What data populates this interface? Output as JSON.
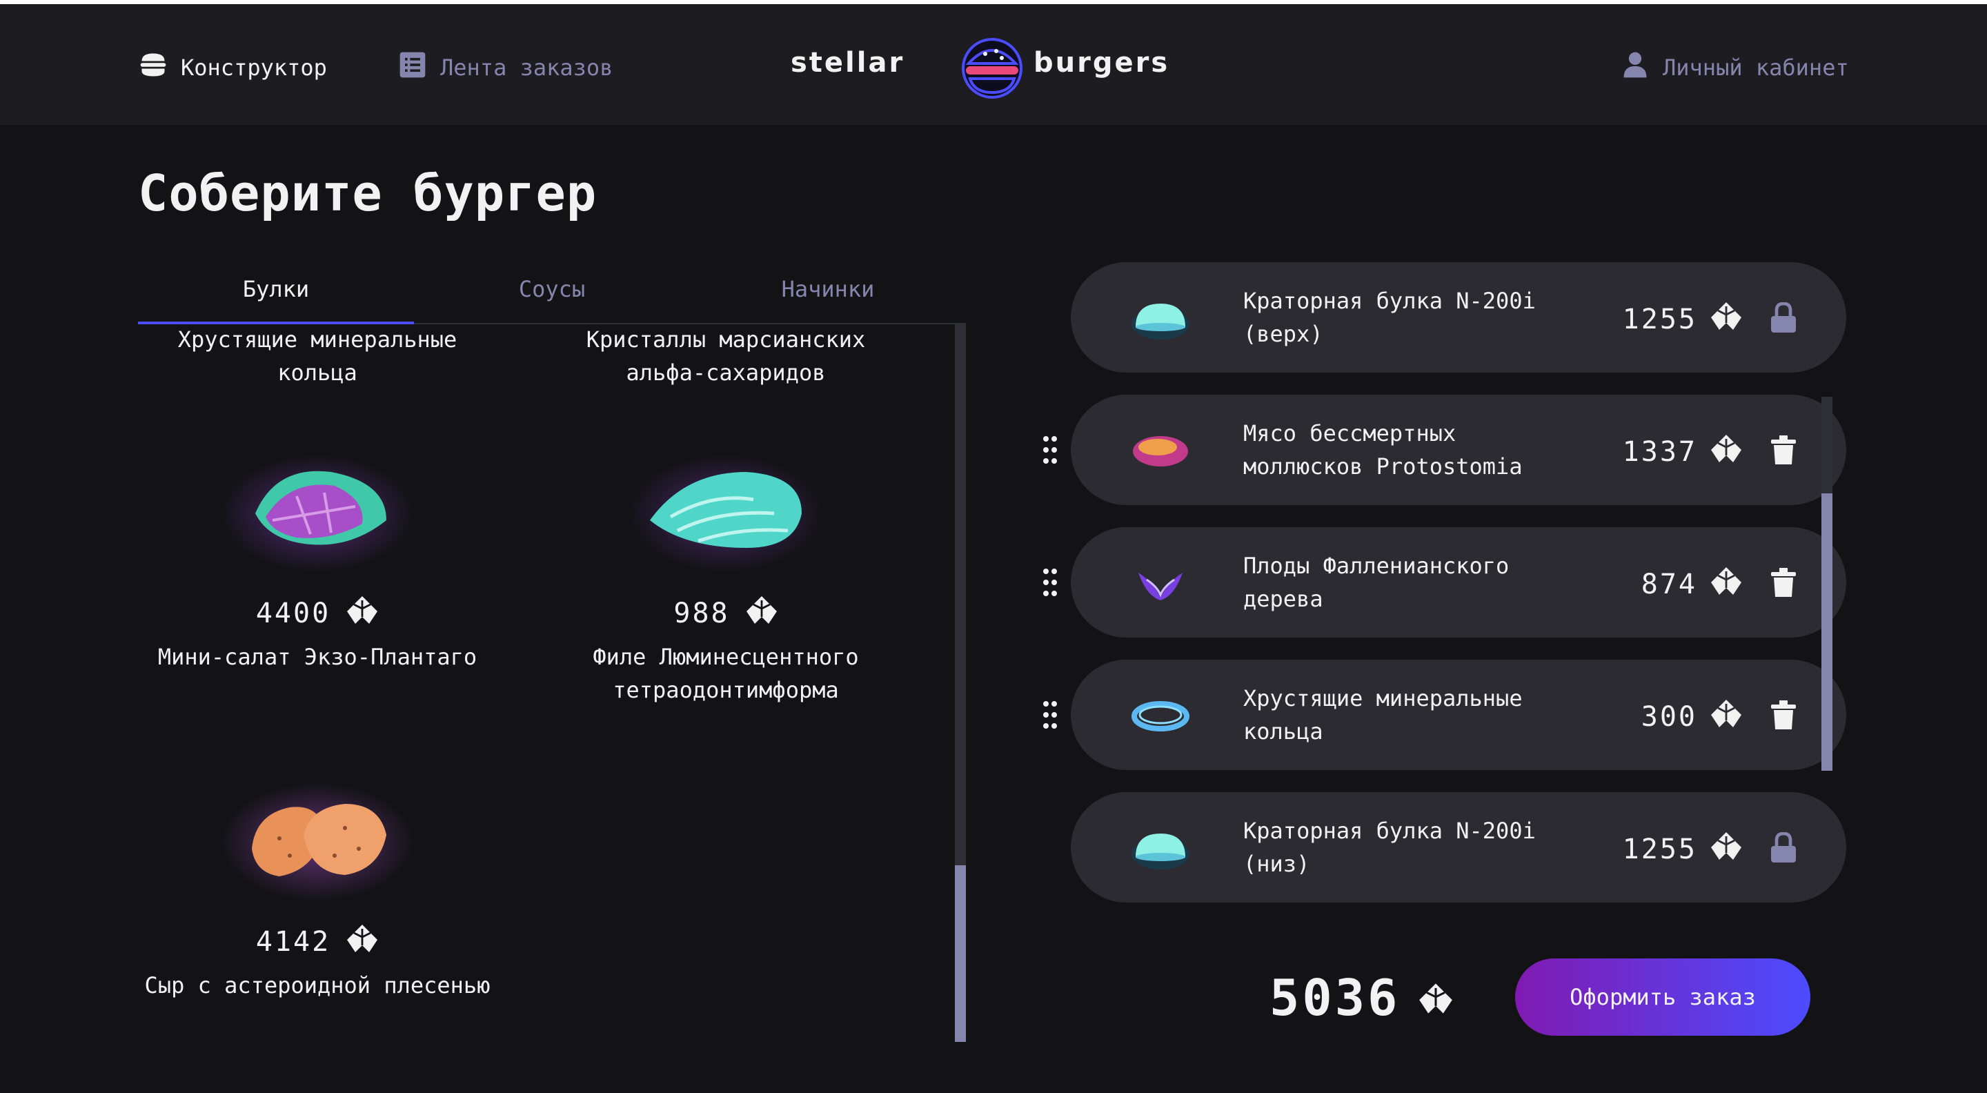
{
  "header": {
    "nav": {
      "constructor": "Конструктор",
      "feed": "Лента заказов",
      "profile": "Личный кабинет"
    },
    "logo": {
      "left_text": "stellar",
      "right_text": "burgers"
    }
  },
  "page": {
    "title": "Соберите бургер"
  },
  "tabs": [
    {
      "label": "Булки",
      "active": true
    },
    {
      "label": "Соусы",
      "active": false
    },
    {
      "label": "Начинки",
      "active": false
    }
  ],
  "ingredients": [
    {
      "name": "Хрустящие минеральные кольца"
    },
    {
      "name": "Кристаллы марсианских альфа-сахаридов"
    },
    {
      "name": "Мини-салат Экзо-Плантаго",
      "price": "4400",
      "icon": "leaf-salad-image"
    },
    {
      "name": "Филе Люминесцентного тетраодонтимформа",
      "price": "988",
      "icon": "fish-fillet-image"
    },
    {
      "name": "Сыр с астероидной плесенью",
      "price": "4142",
      "icon": "cheese-image"
    }
  ],
  "constructor": {
    "items": [
      {
        "name": "Краторная булка N-200i (верх)",
        "price": "1255",
        "locked": true,
        "icon": "bun-image"
      },
      {
        "name": "Мясо бессмертных моллюсков Protostomia",
        "price": "1337",
        "locked": false,
        "icon": "meat-image"
      },
      {
        "name": "Плоды Фалленианского дерева",
        "price": "874",
        "locked": false,
        "icon": "fruit-image"
      },
      {
        "name": "Хрустящие минеральные кольца",
        "price": "300",
        "locked": false,
        "icon": "rings-image"
      },
      {
        "name": "Краторная булка N-200i (низ)",
        "price": "1255",
        "locked": true,
        "icon": "bun-image"
      }
    ],
    "total": "5036",
    "order_button": "Оформить заказ"
  },
  "colors": {
    "background": "#131316",
    "panel": "#1c1c21",
    "muted_text": "#8585ad",
    "accent": "#4c4cff",
    "button_gradient_start": "#801ab2",
    "button_gradient_end": "#4c4cff"
  }
}
